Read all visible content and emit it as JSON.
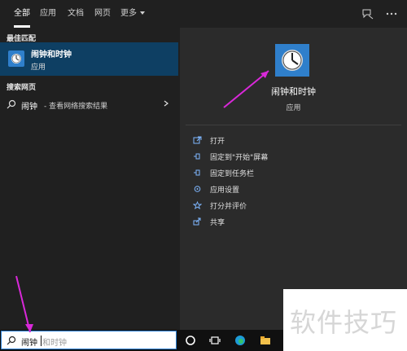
{
  "tabs": [
    {
      "label": "全部"
    },
    {
      "label": "应用"
    },
    {
      "label": "文档"
    },
    {
      "label": "网页"
    },
    {
      "label": "更多"
    }
  ],
  "left": {
    "best_match_label": "最佳匹配",
    "best_title": "闹钟和时钟",
    "best_sub": "应用",
    "web_label": "搜索网页",
    "web_query": "闹钟",
    "web_suffix": " - 查看网络搜索结果"
  },
  "right": {
    "app_name": "闹钟和时钟",
    "app_type": "应用",
    "actions": [
      {
        "label": "打开",
        "icon": "open-icon"
      },
      {
        "label": "固定到\"开始\"屏幕",
        "icon": "pin-icon"
      },
      {
        "label": "固定到任务栏",
        "icon": "pin-taskbar-icon"
      },
      {
        "label": "应用设置",
        "icon": "gear-icon"
      },
      {
        "label": "打分并评价",
        "icon": "star-icon"
      },
      {
        "label": "共享",
        "icon": "share-icon"
      }
    ]
  },
  "taskbar": {
    "search_typed": "闹钟",
    "search_hint": "和时钟"
  },
  "watermark": {
    "text": "软件技巧"
  },
  "colors": {
    "accent": "#0e3f63",
    "app_blue": "#2f7fcb",
    "arrow": "#d928d9"
  }
}
